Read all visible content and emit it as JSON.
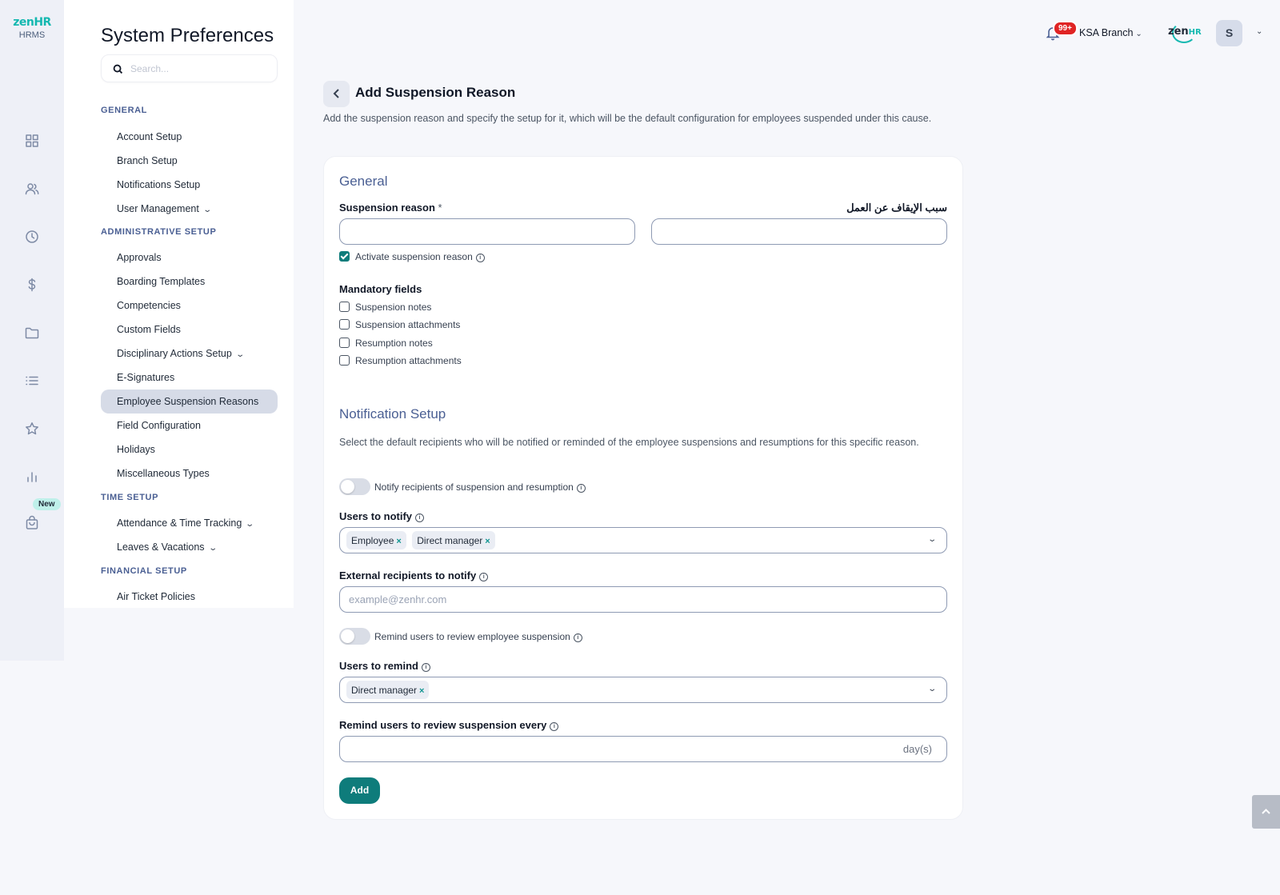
{
  "brand": {
    "logo_main": "zen",
    "logo_accent": "HR",
    "logo_sub": "HRMS"
  },
  "rail": {
    "new_badge": "New",
    "icons": [
      "dashboard-icon",
      "people-icon",
      "clock-icon",
      "dollar-icon",
      "folder-icon",
      "list-icon",
      "star-icon",
      "chart-icon",
      "bag-icon"
    ]
  },
  "sidebar": {
    "title": "System Preferences",
    "search_placeholder": "Search...",
    "sections": {
      "general": "GENERAL",
      "administrative": "ADMINISTRATIVE SETUP",
      "time": "TIME SETUP",
      "financial": "FINANCIAL SETUP"
    },
    "items": {
      "account_setup": "Account Setup",
      "branch_setup": "Branch Setup",
      "notifications_setup": "Notifications Setup",
      "user_management": "User Management",
      "approvals": "Approvals",
      "boarding_templates": "Boarding Templates",
      "competencies": "Competencies",
      "custom_fields": "Custom Fields",
      "disciplinary_actions": "Disciplinary Actions Setup",
      "e_signatures": "E-Signatures",
      "employee_suspension_reasons": "Employee Suspension Reasons",
      "field_configuration": "Field Configuration",
      "holidays": "Holidays",
      "miscellaneous_types": "Miscellaneous Types",
      "attendance": "Attendance & Time Tracking",
      "leaves": "Leaves & Vacations",
      "air_ticket": "Air Ticket Policies"
    },
    "active_item": "Employee Suspension Reasons"
  },
  "header": {
    "notifications_count": "99+",
    "branch": "KSA Branch",
    "company_logo_main": "zen",
    "company_logo_accent": "HR",
    "avatar_initial": "S"
  },
  "page": {
    "title": "Add Suspension Reason",
    "description": "Add the suspension reason and specify the setup for it, which will be the default configuration for employees suspended under this cause."
  },
  "form": {
    "general_title": "General",
    "suspension_reason_label": "Suspension reason",
    "required_mark": "*",
    "suspension_reason_ar_label": "سبب الإيقاف عن العمل",
    "suspension_reason_value": "",
    "suspension_reason_ar_value": "",
    "activate_label": "Activate suspension reason",
    "activate_checked": true,
    "mandatory_title": "Mandatory fields",
    "mandatory": [
      "Suspension notes",
      "Suspension attachments",
      "Resumption notes",
      "Resumption attachments"
    ],
    "notification_title": "Notification Setup",
    "notification_desc": "Select the default recipients who will be notified or reminded of the employee suspensions and resumptions for this specific reason.",
    "notify_toggle_label": "Notify recipients of suspension and resumption",
    "notify_toggle_on": false,
    "users_to_notify_label": "Users to notify",
    "users_to_notify": [
      "Employee",
      "Direct manager"
    ],
    "external_label": "External recipients to notify",
    "external_placeholder": "example@zenhr.com",
    "remind_toggle_label": "Remind users to review employee suspension",
    "remind_toggle_on": false,
    "users_to_remind_label": "Users to remind",
    "users_to_remind": [
      "Direct manager"
    ],
    "remind_every_label": "Remind users to review suspension every",
    "remind_every_suffix": "day(s)",
    "remind_every_value": "",
    "add_button": "Add",
    "tag_remove_symbol": "×"
  }
}
